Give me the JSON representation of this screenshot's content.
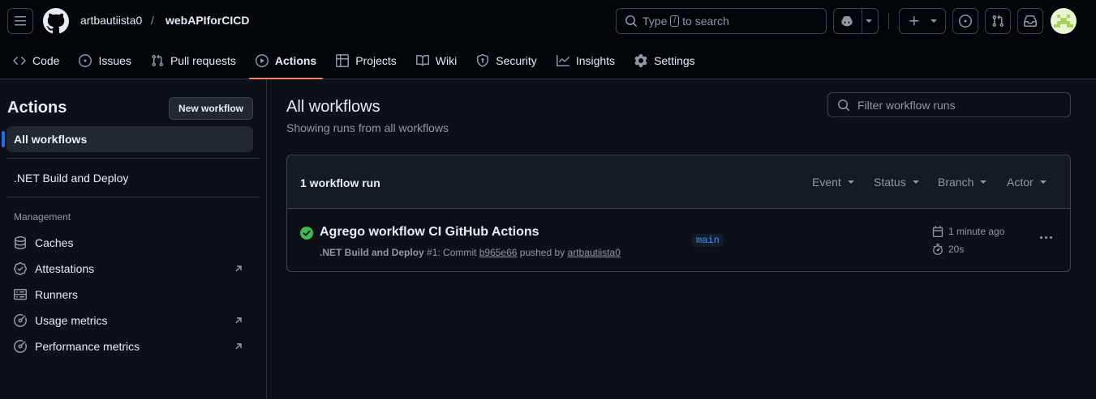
{
  "header": {
    "owner": "artbautiista0",
    "separator": "/",
    "repo": "webAPIforCICD",
    "search_text_before": "Type",
    "search_key": "/",
    "search_text_after": "to search"
  },
  "tabs": [
    {
      "label": "Code",
      "icon": "code-icon"
    },
    {
      "label": "Issues",
      "icon": "issue-icon"
    },
    {
      "label": "Pull requests",
      "icon": "pull-request-icon"
    },
    {
      "label": "Actions",
      "icon": "play-icon"
    },
    {
      "label": "Projects",
      "icon": "table-icon"
    },
    {
      "label": "Wiki",
      "icon": "book-icon"
    },
    {
      "label": "Security",
      "icon": "shield-icon"
    },
    {
      "label": "Insights",
      "icon": "graph-icon"
    },
    {
      "label": "Settings",
      "icon": "gear-icon"
    }
  ],
  "sidebar": {
    "title": "Actions",
    "new_workflow": "New workflow",
    "all_workflows": "All workflows",
    "workflow": ".NET Build and Deploy",
    "management_heading": "Management",
    "management": [
      {
        "label": "Caches",
        "icon": "database-icon"
      },
      {
        "label": "Attestations",
        "icon": "verified-icon"
      },
      {
        "label": "Runners",
        "icon": "server-icon"
      },
      {
        "label": "Usage metrics",
        "icon": "meter-icon"
      },
      {
        "label": "Performance metrics",
        "icon": "meter-icon"
      }
    ]
  },
  "main": {
    "title": "All workflows",
    "subtitle": "Showing runs from all workflows",
    "filter_placeholder": "Filter workflow runs",
    "run_count": "1 workflow run",
    "filters": [
      "Event",
      "Status",
      "Branch",
      "Actor"
    ],
    "run": {
      "title": "Agrego workflow CI GitHub Actions",
      "workflow": ".NET Build and Deploy",
      "number": "#1",
      "meta_commit": ": Commit",
      "commit": "b965e66",
      "meta_pushed": "pushed by",
      "actor": "artbautiista0",
      "branch": "main",
      "time_ago": "1 minute ago",
      "duration": "20s",
      "status_color": "#3fb950"
    }
  },
  "colors": {
    "accent_underline": "#f78166",
    "link": "#4493f8",
    "success": "#3fb950"
  }
}
